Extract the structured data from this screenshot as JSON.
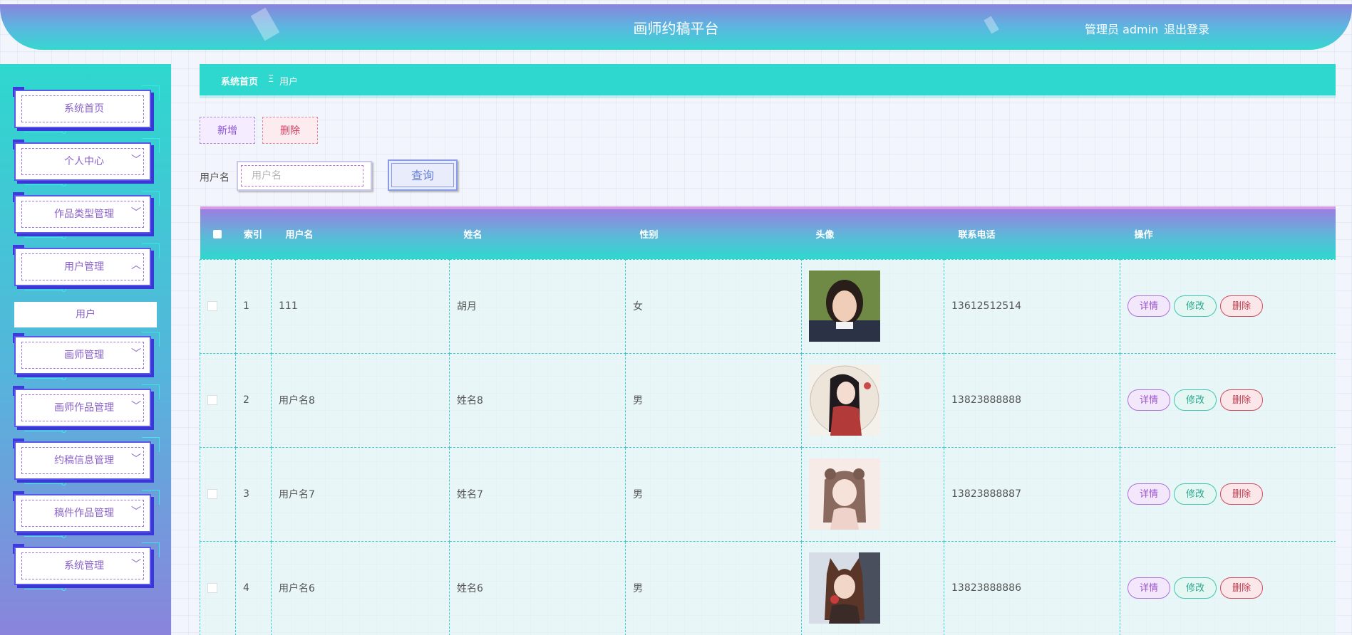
{
  "header": {
    "title": "画师约稿平台",
    "user_label": "管理员 admin",
    "logout_label": "退出登录"
  },
  "sidebar": {
    "items": [
      {
        "label": "系统首页",
        "expandable": false
      },
      {
        "label": "个人中心",
        "expandable": true
      },
      {
        "label": "作品类型管理",
        "expandable": true
      },
      {
        "label": "用户管理",
        "expandable": true,
        "expanded": true
      },
      {
        "label": "画师管理",
        "expandable": true
      },
      {
        "label": "画师作品管理",
        "expandable": true
      },
      {
        "label": "约稿信息管理",
        "expandable": true
      },
      {
        "label": "稿件作品管理",
        "expandable": true
      },
      {
        "label": "系统管理",
        "expandable": true
      }
    ],
    "sub_item": "用户",
    "chevron_down": "﹀",
    "chevron_up": "︿"
  },
  "breadcrumb": {
    "home": "系统首页",
    "separator": "Ξ",
    "current": "用户"
  },
  "toolbar": {
    "add_label": "新增",
    "delete_label": "删除"
  },
  "search": {
    "label": "用户名",
    "placeholder": "用户名",
    "value": "",
    "query_label": "查询"
  },
  "table": {
    "headers": [
      "",
      "索引",
      "用户名",
      "姓名",
      "性别",
      "头像",
      "联系电话",
      "操作"
    ],
    "rows": [
      {
        "index": "1",
        "username": "111",
        "name": "胡月",
        "gender": "女",
        "phone": "13612512514",
        "avatar_icon": "avatar-photo-girl"
      },
      {
        "index": "2",
        "username": "用户名8",
        "name": "姓名8",
        "gender": "男",
        "phone": "13823888888",
        "avatar_icon": "avatar-illustration-red"
      },
      {
        "index": "3",
        "username": "用户名7",
        "name": "姓名7",
        "gender": "男",
        "phone": "13823888887",
        "avatar_icon": "avatar-illustration-pastel"
      },
      {
        "index": "4",
        "username": "用户名6",
        "name": "姓名6",
        "gender": "男",
        "phone": "13823888886",
        "avatar_icon": "avatar-illustration-fox"
      }
    ],
    "actions": {
      "detail": "详情",
      "edit": "修改",
      "delete": "删除"
    }
  },
  "colors": {
    "accent_teal": "#2ed8ce",
    "accent_purple": "#8a84dc",
    "menu_text": "#8a62c8"
  }
}
